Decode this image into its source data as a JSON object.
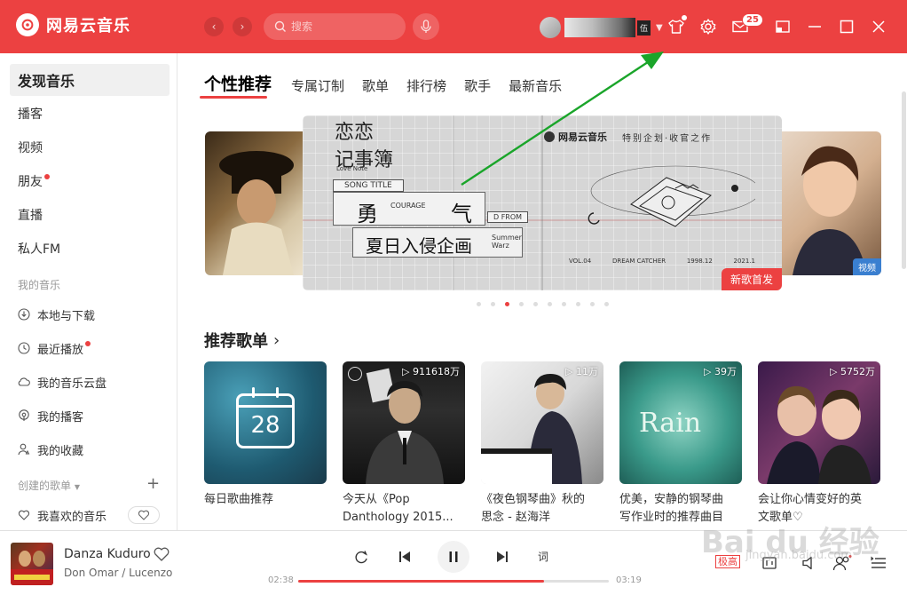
{
  "app": {
    "name": "网易云音乐"
  },
  "topbar": {
    "search_placeholder": "搜索",
    "vip_badge": "伍",
    "message_count": "25"
  },
  "sidebar": {
    "items": [
      {
        "label": "发现音乐"
      },
      {
        "label": "播客"
      },
      {
        "label": "视频"
      },
      {
        "label": "朋友"
      },
      {
        "label": "直播"
      },
      {
        "label": "私人FM"
      }
    ],
    "my_music_title": "我的音乐",
    "my_music": [
      {
        "label": "本地与下载"
      },
      {
        "label": "最近播放"
      },
      {
        "label": "我的音乐云盘"
      },
      {
        "label": "我的播客"
      },
      {
        "label": "我的收藏"
      }
    ],
    "created_title": "创建的歌单",
    "created": [
      {
        "label": "我喜欢的音乐"
      }
    ]
  },
  "tabs": [
    "个性推荐",
    "专属订制",
    "歌单",
    "排行榜",
    "歌手",
    "最新音乐"
  ],
  "banner": {
    "title_line1": "恋恋",
    "title_line2": "记事簿",
    "love_note": "Love Note",
    "song_title": "SONG TITLE",
    "yong": "勇",
    "courage": "COURAGE",
    "qi": "气",
    "d_from": "D FROM",
    "xiari": "夏日入侵企画",
    "summer": "Summer",
    "warz": "Warz",
    "brand": "网易云音乐",
    "project": "特别企划·收官之作",
    "vol": "VOL.04",
    "dream": "DREAM CATCHER",
    "date1": "1998.12",
    "date2": "2021.1",
    "tag": "新歌首发",
    "right_tag": "视频"
  },
  "carousel": {
    "count": 10,
    "active": 2
  },
  "recommend": {
    "title": "推荐歌单",
    "playlists": [
      {
        "title": "每日歌曲推荐",
        "title2": "",
        "count": "",
        "calendar_day": "28"
      },
      {
        "title": "今天从《Pop",
        "title2": "Danthology 2015...",
        "count": "▷ 911618万"
      },
      {
        "title": "《夜色钢琴曲》秋的",
        "title2": "思念 - 赵海洋",
        "count": "▷ 11万"
      },
      {
        "title": "优美，安静的钢琴曲",
        "title2": "写作业时的推荐曲目",
        "count": "▷ 39万",
        "cover_text": "Rain"
      },
      {
        "title": "会让你心情变好的英",
        "title2": "文歌单♡",
        "count": "▷ 5752万"
      }
    ]
  },
  "player": {
    "song": "Danza Kuduro",
    "artist": "Don Omar / Lucenzo",
    "lyric_label": "词",
    "time_current": "02:38",
    "time_total": "03:19",
    "progress_percent": 79,
    "quality": "极高"
  },
  "watermark": {
    "text": "Bai du 经验",
    "sub": "jingyan.baidu.com"
  },
  "colors": {
    "accent": "#ec4141",
    "annotation": "#1aa52a"
  }
}
